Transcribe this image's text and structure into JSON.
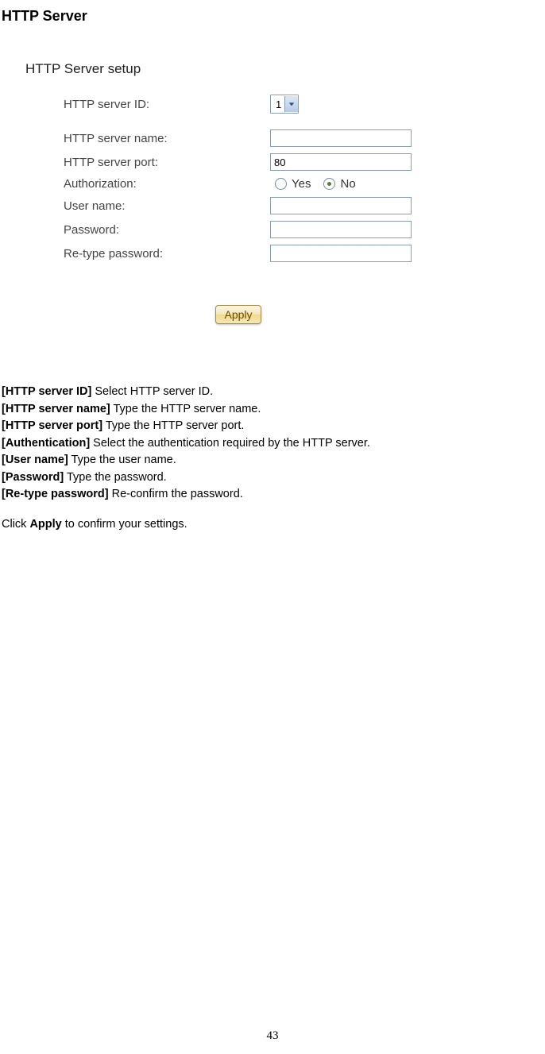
{
  "title": "HTTP Server",
  "form": {
    "heading": "HTTP Server setup",
    "labels": {
      "id": "HTTP server ID:",
      "name": "HTTP server name:",
      "port": "HTTP server port:",
      "auth": "Authorization:",
      "user": "User name:",
      "pass": "Password:",
      "repass": "Re-type password:"
    },
    "values": {
      "id": "1",
      "name": "",
      "port": "80",
      "auth_yes": "Yes",
      "auth_no": "No",
      "auth_selected": "no",
      "user": "",
      "pass": "",
      "repass": ""
    },
    "apply": "Apply"
  },
  "descriptions": {
    "d1_b": "[HTTP server ID]",
    "d1_t": " Select HTTP server ID.",
    "d2_b": "[HTTP server name]",
    "d2_t": " Type the HTTP server name.",
    "d3_b": "[HTTP server port]",
    "d3_t": " Type the HTTP server port.",
    "d4_b": "[Authentication]",
    "d4_t": " Select the authentication required by the HTTP server.",
    "d5_b": "[User name]",
    "d5_t": " Type the user name.",
    "d6_b": "[Password]",
    "d6_t": " Type the password.",
    "d7_b": "[Re-type password]",
    "d7_t": " Re-confirm the password.",
    "d8_a": "Click ",
    "d8_b": "Apply",
    "d8_c": " to confirm your settings."
  },
  "page_number": "43"
}
